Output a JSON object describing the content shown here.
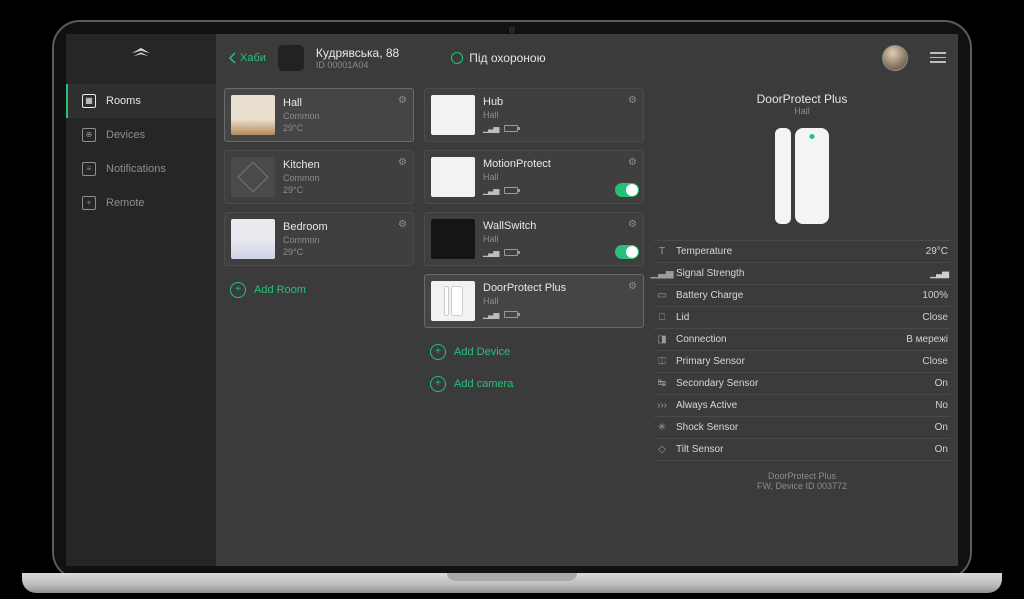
{
  "nav": {
    "back": "Хаби",
    "items": [
      {
        "label": "Rooms"
      },
      {
        "label": "Devices"
      },
      {
        "label": "Notifications"
      },
      {
        "label": "Remote"
      }
    ]
  },
  "hub": {
    "name": "Кудрявська, 88",
    "id": "ID 00001A04"
  },
  "status": {
    "label": "Під охороною"
  },
  "rooms": {
    "add": "Add Room",
    "items": [
      {
        "name": "Hall",
        "group": "Common",
        "temp": "29°C"
      },
      {
        "name": "Kitchen",
        "group": "Common",
        "temp": "29°C"
      },
      {
        "name": "Bedroom",
        "group": "Common",
        "temp": "29°C"
      }
    ]
  },
  "devices": {
    "add_device": "Add Device",
    "add_camera": "Add camera",
    "items": [
      {
        "name": "Hub",
        "room": "Hall",
        "toggle": false
      },
      {
        "name": "MotionProtect",
        "room": "Hall",
        "toggle": true
      },
      {
        "name": "WallSwitch",
        "room": "Hall",
        "toggle": true
      },
      {
        "name": "DoorProtect Plus",
        "room": "Hall",
        "toggle": false,
        "selected": true
      }
    ]
  },
  "detail": {
    "name": "DoorProtect Plus",
    "room": "Hall",
    "props": [
      {
        "icon": "T",
        "label": "Temperature",
        "value": "29°C"
      },
      {
        "icon": "sig",
        "label": "Signal Strength",
        "value": "sig"
      },
      {
        "icon": "bat",
        "label": "Battery Charge",
        "value": "100%"
      },
      {
        "icon": "lid",
        "label": "Lid",
        "value": "Close"
      },
      {
        "icon": "con",
        "label": "Connection",
        "value": "В мережі"
      },
      {
        "icon": "pri",
        "label": "Primary Sensor",
        "value": "Close"
      },
      {
        "icon": "sec",
        "label": "Secondary Sensor",
        "value": "On"
      },
      {
        "icon": "act",
        "label": "Always Active",
        "value": "No"
      },
      {
        "icon": "sho",
        "label": "Shock Sensor",
        "value": "On"
      },
      {
        "icon": "til",
        "label": "Tilt Sensor",
        "value": "On"
      }
    ],
    "footer_name": "DoorProtect Plus",
    "footer_id": "FW, Device ID 003772"
  }
}
